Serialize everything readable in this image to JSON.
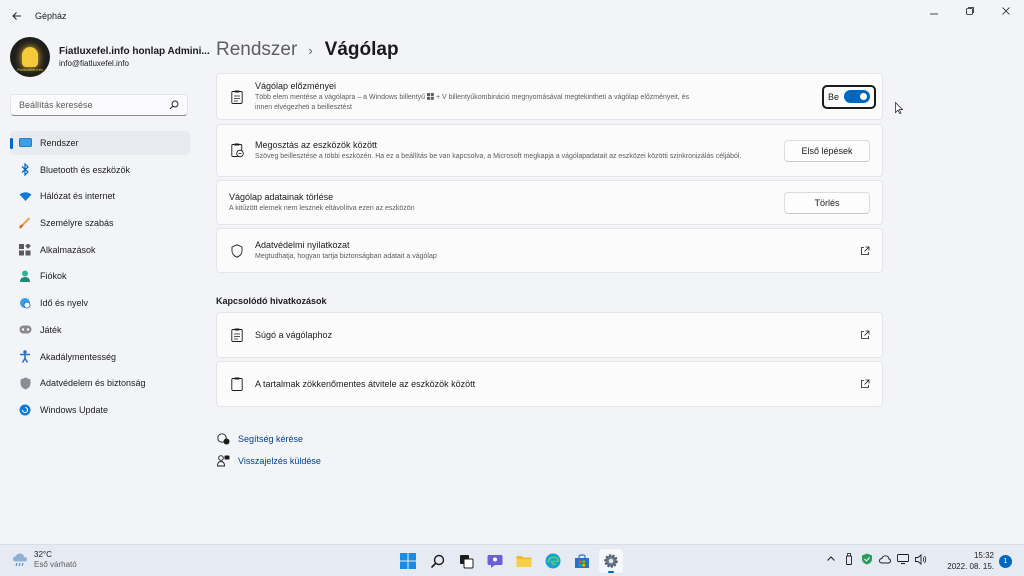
{
  "window": {
    "title": "Gépház"
  },
  "profile": {
    "name": "Fiatluxefel.info honlap Admini...",
    "email": "info@fiatluxefel.info",
    "avatar_text": "Fiatluxefel.info"
  },
  "search": {
    "placeholder": "Beállítás keresése"
  },
  "sidebar": {
    "items": [
      {
        "label": "Rendszer",
        "icon": "system-icon",
        "active": true
      },
      {
        "label": "Bluetooth és eszközök",
        "icon": "bluetooth-icon"
      },
      {
        "label": "Hálózat és internet",
        "icon": "wifi-icon"
      },
      {
        "label": "Személyre szabás",
        "icon": "brush-icon"
      },
      {
        "label": "Alkalmazások",
        "icon": "apps-icon"
      },
      {
        "label": "Fiókok",
        "icon": "person-icon"
      },
      {
        "label": "Idő és nyelv",
        "icon": "globe-clock-icon"
      },
      {
        "label": "Játék",
        "icon": "gamepad-icon"
      },
      {
        "label": "Akadálymentesség",
        "icon": "accessibility-icon"
      },
      {
        "label": "Adatvédelem és biztonság",
        "icon": "shield-icon"
      },
      {
        "label": "Windows Update",
        "icon": "windows-update-icon"
      }
    ]
  },
  "breadcrumb": {
    "parent": "Rendszer",
    "separator": "›",
    "current": "Vágólap"
  },
  "cards": {
    "history": {
      "title": "Vágólap előzményei",
      "desc1": "Több elem mentése a vágólapra – a Windows billentyű",
      "desc2": "+ V billentyűkombináció megnyomásával megtekintheti a vágólap előzményeit, és",
      "desc3": "innen elvégezheti a beillesztést",
      "toggle_label": "Be",
      "toggle_on": true
    },
    "share": {
      "title": "Megosztás az eszközök között",
      "desc": "Szöveg beillesztése a többi eszközén. Ha ez a beállítás be van kapcsolva, a Microsoft megkapja a vágólapadatait az eszközei közötti szinkronizálás céljából.",
      "button": "Első lépések"
    },
    "clear": {
      "title": "Vágólap adatainak törlése",
      "desc": "A kitűzött elemek nem lesznek eltávolítva ezen az eszközön",
      "button": "Törlés"
    },
    "privacy": {
      "title": "Adatvédelmi nyilatkozat",
      "desc": "Megtudhatja, hogyan tartja biztonságban adatait a vágólap"
    }
  },
  "related": {
    "title": "Kapcsolódó hivatkozások",
    "help": "Súgó a vágólaphoz",
    "transfer": "A tartalmak zökkenőmentes átvitele az eszközök között"
  },
  "links": {
    "get_help": "Segítség kérése",
    "feedback": "Visszajelzés küldése"
  },
  "taskbar": {
    "temp": "32°C",
    "condition": "Eső várható",
    "time": "15:32",
    "date": "2022. 08. 15.",
    "notifications": "1",
    "apps": [
      "windows-start-icon",
      "search-icon",
      "task-view-icon",
      "chat-icon",
      "file-explorer-icon",
      "edge-icon",
      "store-icon",
      "settings-icon"
    ]
  },
  "colors": {
    "accent": "#0067c0",
    "background": "#f3f4f8",
    "card": "#fbfbfc"
  }
}
